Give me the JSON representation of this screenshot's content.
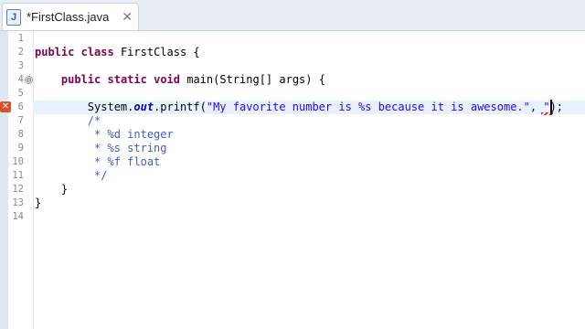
{
  "tab": {
    "title": "*FirstClass.java",
    "icon": "java-file-icon",
    "icon_letter": "J",
    "close": "✕"
  },
  "editor": {
    "current_line": 6,
    "error_line": 6,
    "fold_line": 4,
    "fold_glyph": "⊖",
    "lines": [
      {
        "num": "1",
        "segs": []
      },
      {
        "num": "2",
        "segs": [
          {
            "t": "public",
            "c": "kw"
          },
          {
            "t": " "
          },
          {
            "t": "class",
            "c": "kw"
          },
          {
            "t": " FirstClass {"
          }
        ]
      },
      {
        "num": "3",
        "segs": []
      },
      {
        "num": "4",
        "segs": [
          {
            "t": "    "
          },
          {
            "t": "public",
            "c": "kw"
          },
          {
            "t": " "
          },
          {
            "t": "static",
            "c": "kw"
          },
          {
            "t": " "
          },
          {
            "t": "void",
            "c": "kw"
          },
          {
            "t": " main(String[] args) {"
          }
        ]
      },
      {
        "num": "5",
        "segs": []
      },
      {
        "num": "6",
        "segs": [
          {
            "t": "        System."
          },
          {
            "t": "out",
            "c": "fi"
          },
          {
            "t": ".printf("
          },
          {
            "t": "\"My favorite number is %s because it is awesome.\"",
            "c": "st"
          },
          {
            "t": ", "
          },
          {
            "t": "\"",
            "c": "st"
          },
          {
            "t": ");"
          }
        ]
      },
      {
        "num": "7",
        "segs": [
          {
            "t": "        /*",
            "c": "cm"
          }
        ]
      },
      {
        "num": "8",
        "segs": [
          {
            "t": "         * %d integer",
            "c": "cm"
          }
        ]
      },
      {
        "num": "9",
        "segs": [
          {
            "t": "         * %s string",
            "c": "cm"
          }
        ]
      },
      {
        "num": "10",
        "segs": [
          {
            "t": "         * %f float",
            "c": "cm"
          }
        ]
      },
      {
        "num": "11",
        "segs": [
          {
            "t": "         */",
            "c": "cm"
          }
        ]
      },
      {
        "num": "12",
        "segs": [
          {
            "t": "    }"
          }
        ]
      },
      {
        "num": "13",
        "segs": [
          {
            "t": "}"
          }
        ]
      },
      {
        "num": "14",
        "segs": []
      }
    ]
  },
  "colors": {
    "keyword": "#7f0055",
    "string": "#2a00ff",
    "comment": "#3f5fbf",
    "field": "#0000c0",
    "current_line": "#e8f2fe",
    "error": "#d9502b"
  }
}
